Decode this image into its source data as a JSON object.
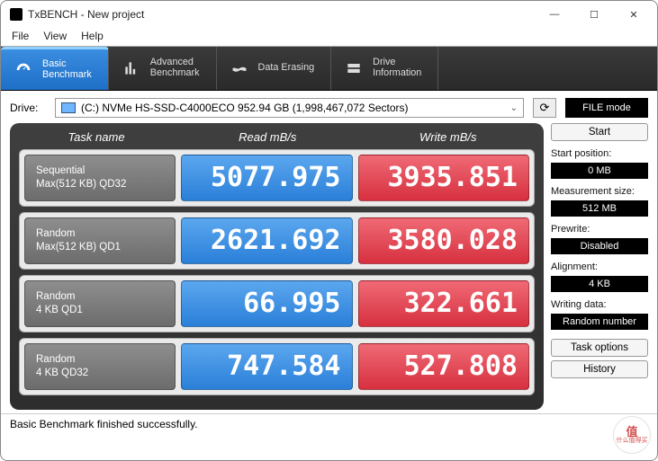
{
  "window": {
    "title": "TxBENCH - New project"
  },
  "menu": {
    "file": "File",
    "view": "View",
    "help": "Help"
  },
  "tabs": {
    "basic": {
      "l1": "Basic",
      "l2": "Benchmark"
    },
    "advanced": {
      "l1": "Advanced",
      "l2": "Benchmark"
    },
    "erase": {
      "l1": "Data Erasing"
    },
    "drive": {
      "l1": "Drive",
      "l2": "Information"
    }
  },
  "drive": {
    "label": "Drive:",
    "selected": "(C:) NVMe HS-SSD-C4000ECO  952.94 GB (1,998,467,072 Sectors)",
    "filemode": "FILE mode"
  },
  "headers": {
    "task": "Task name",
    "read": "Read mB/s",
    "write": "Write mB/s"
  },
  "rows": [
    {
      "name1": "Sequential",
      "name2": "Max(512 KB) QD32",
      "read": "5077.975",
      "write": "3935.851"
    },
    {
      "name1": "Random",
      "name2": "Max(512 KB) QD1",
      "read": "2621.692",
      "write": "3580.028"
    },
    {
      "name1": "Random",
      "name2": "4 KB QD1",
      "read": "66.995",
      "write": "322.661"
    },
    {
      "name1": "Random",
      "name2": "4 KB QD32",
      "read": "747.584",
      "write": "527.808"
    }
  ],
  "side": {
    "start": "Start",
    "startpos_lbl": "Start position:",
    "startpos": "0 MB",
    "msize_lbl": "Measurement size:",
    "msize": "512 MB",
    "prewrite_lbl": "Prewrite:",
    "prewrite": "Disabled",
    "align_lbl": "Alignment:",
    "align": "4 KB",
    "wdata_lbl": "Writing data:",
    "wdata": "Random number",
    "taskopt": "Task options",
    "history": "History"
  },
  "status": "Basic Benchmark finished successfully.",
  "watermark": {
    "main": "值",
    "sub": "什么值得买"
  }
}
